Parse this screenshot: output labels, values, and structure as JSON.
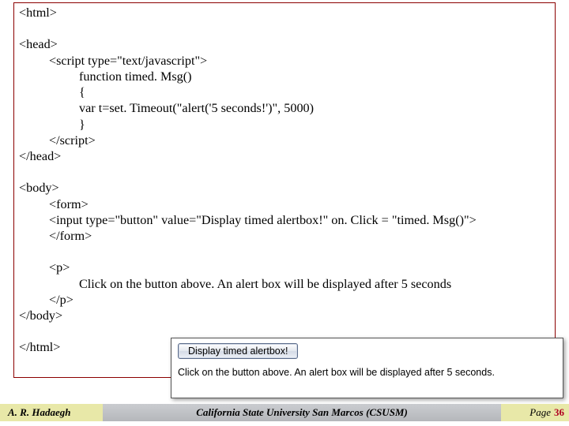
{
  "code": {
    "l1": "<html>",
    "l2": "<head>",
    "l3": "<script type=\"text/javascript\">",
    "l4": "function timed. Msg()",
    "l5": "{",
    "l6": "var t=set. Timeout(\"alert('5 seconds!')\", 5000)",
    "l7": "}",
    "l8": "</script>",
    "l9": "</head>",
    "l10": "<body>",
    "l11": "<form>",
    "l12": "<input type=\"button\" value=\"Display timed alertbox!\" on. Click = \"timed. Msg()\">",
    "l13": "</form>",
    "l14": "<p>",
    "l15": "Click on the button above. An alert box will be displayed after 5 seconds",
    "l16": "</p>",
    "l17": "</body>",
    "l18": "</html>"
  },
  "inset": {
    "button_label": "Display timed alertbox!",
    "caption": "Click on the button above. An alert box will be displayed after 5 seconds."
  },
  "footer": {
    "author": "A. R. Hadaegh",
    "institution": "California State University San Marcos (CSUSM)",
    "page_label": "Page",
    "page_number": "36"
  }
}
